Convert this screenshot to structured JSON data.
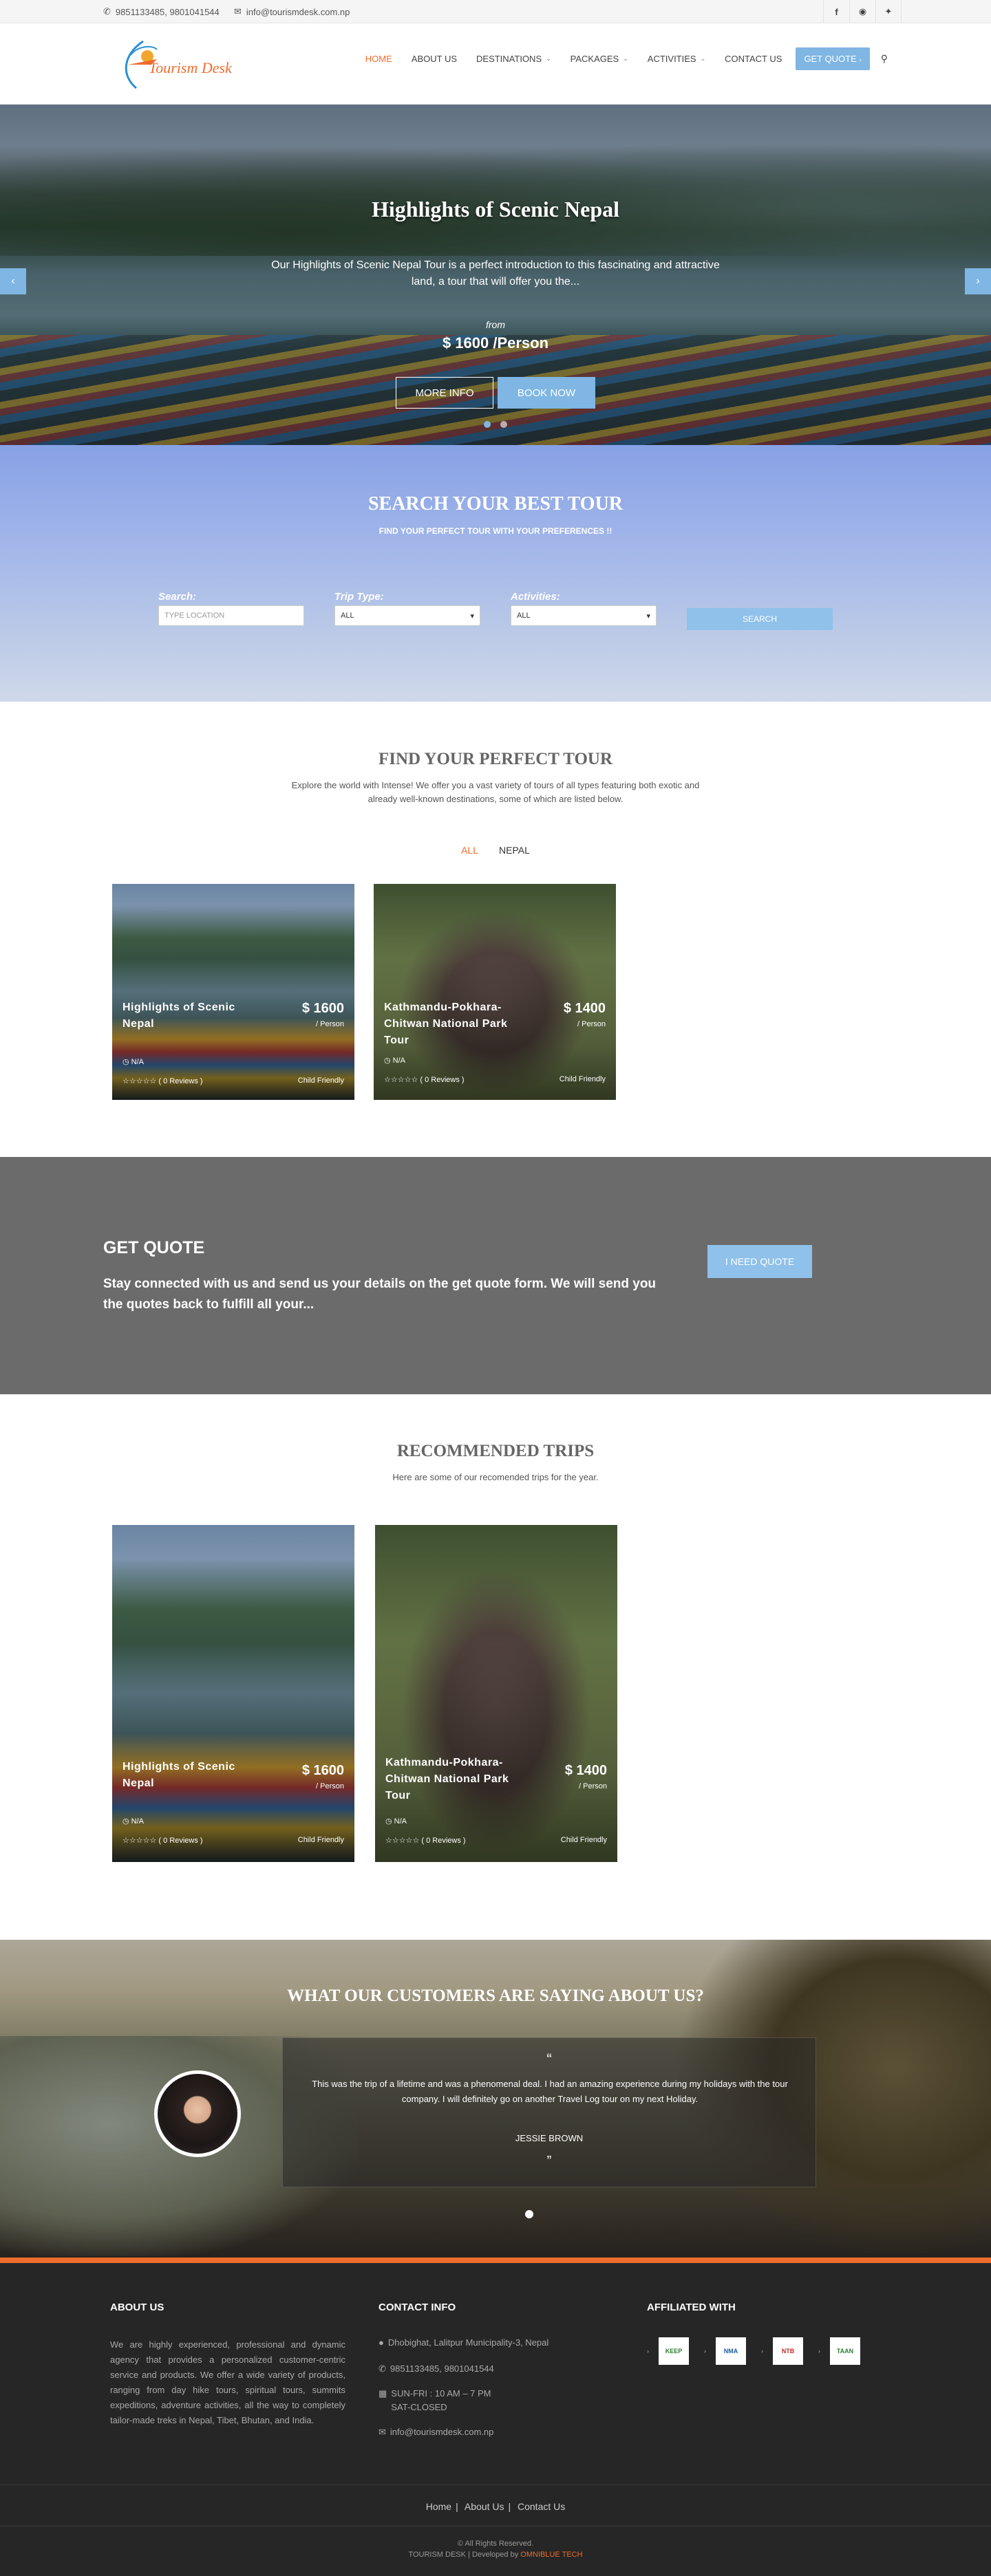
{
  "topbar": {
    "phone": "9851133485, 9801041544",
    "email": "info@tourismdesk.com.np",
    "social": [
      "facebook-icon",
      "instagram-icon",
      "twitter-icon"
    ]
  },
  "brand": {
    "name": "Tourism Desk",
    "accent": "#ef6c2f",
    "button_blue": "#7fb6e3"
  },
  "nav": {
    "home": "HOME",
    "about": "ABOUT US",
    "destinations": "DESTINATIONS",
    "packages": "PACKAGES",
    "activities": "ACTIVITIES",
    "contact": "CONTACT US",
    "quote": "GET QUOTE"
  },
  "hero": {
    "title": "Highlights of Scenic Nepal",
    "description": "Our Highlights of Scenic Nepal Tour is a perfect introduction to this fascinating and attractive land, a tour that will offer you the...",
    "from": "from",
    "price": "$ 1600 /Person",
    "more_info": "MORE INFO",
    "book_now": "BOOK NOW"
  },
  "search": {
    "title": "SEARCH YOUR BEST TOUR",
    "subtitle": "FIND YOUR PERFECT TOUR WITH YOUR PREFERENCES !!",
    "search_label": "Search:",
    "search_placeholder": "TYPE LOCATION",
    "trip_label": "Trip Type:",
    "trip_value": "ALL",
    "activities_label": "Activities:",
    "activities_value": "ALL",
    "button": "SEARCH"
  },
  "find": {
    "title": "FIND YOUR PERFECT TOUR",
    "description": "Explore the world with Intense! We offer you a vast variety of tours of all types featuring both exotic and already well-known destinations, some of which are listed below.",
    "tabs": [
      "ALL",
      "NEPAL"
    ]
  },
  "tours": [
    {
      "title": "Highlights of Scenic Nepal",
      "price": "$ 1600",
      "per": "/ Person",
      "duration": "N/A",
      "reviews": "( 0 Reviews )",
      "tag": "Child Friendly",
      "rating": 0
    },
    {
      "title": "Kathmandu-Pokhara-Chitwan National Park Tour",
      "price": "$ 1400",
      "per": "/ Person",
      "duration": "N/A",
      "reviews": "( 0 Reviews )",
      "tag": "Child Friendly",
      "rating": 0
    }
  ],
  "quote": {
    "title": "GET QUOTE",
    "text": "Stay connected with us and send us your details on the get quote form. We will send you the quotes back to fulfill all your...",
    "button": "I NEED QUOTE"
  },
  "recommended": {
    "title": "RECOMMENDED TRIPS",
    "description": "Here are some of our recomended trips for the year."
  },
  "testimonial": {
    "title": "WHAT OUR CUSTOMERS ARE SAYING ABOUT US?",
    "text": "This was the trip of a lifetime and was a phenomenal deal. I had an amazing experience during my holidays with the tour company. I will definitely go on another Travel Log tour on my next Holiday.",
    "name": "JESSIE BROWN"
  },
  "footer": {
    "about_title": "ABOUT US",
    "about_text": "We are highly experienced, professional and dynamic agency that provides a personalized customer-centric service and products. We offer a wide variety of products, ranging from day hike tours, spiritual tours, summits expeditions, adventure activities, all the way to completely tailor-made treks in Nepal, Tibet, Bhutan, and India.",
    "contact_title": "CONTACT INFO",
    "address": "Dhobighat, Lalitpur Municipality-3, Nepal",
    "phone": "9851133485, 9801041544",
    "hours1": "SUN-FRI : 10 AM – 7 PM",
    "hours2": "SAT-CLOSED",
    "email": "info@tourismdesk.com.np",
    "affiliated_title": "AFFILIATED WITH",
    "affiliates": [
      "KEEP",
      "NMA",
      "NTB",
      "TAAN"
    ],
    "links": [
      "Home",
      "About Us",
      "Contact Us"
    ],
    "copyright": "© All Rights Reserved.",
    "developed_prefix": "TOURISM DESK | Developed by",
    "developer": "OMNIBLUE TECH"
  }
}
